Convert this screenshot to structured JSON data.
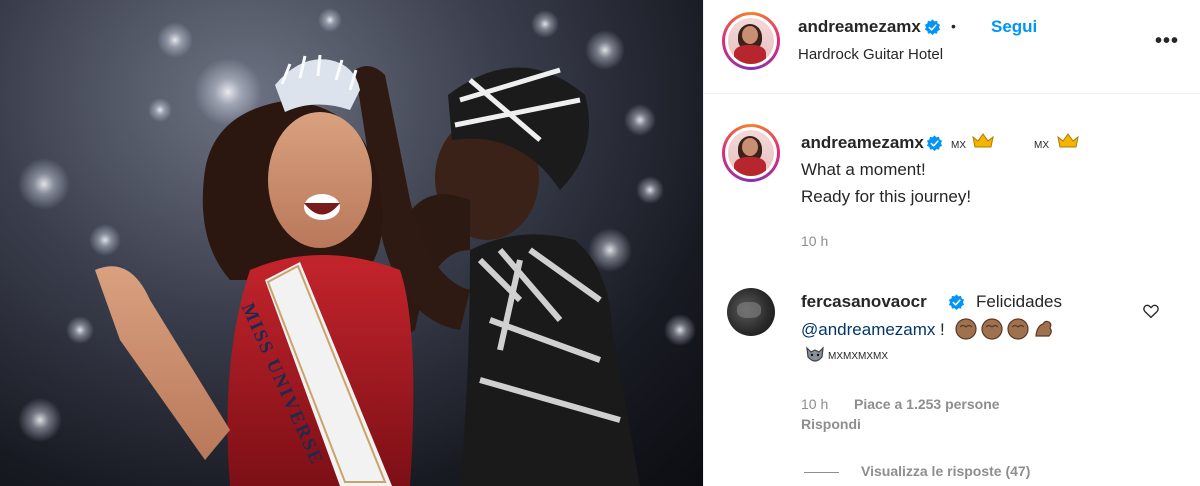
{
  "post": {
    "header": {
      "username": "andreamezamx",
      "follow_label": "Segui",
      "location": "Hardrock Guitar Hotel",
      "more_label": "•••"
    },
    "caption": {
      "username": "andreamezamx",
      "flag_1": "MX",
      "flag_2": "MX",
      "line_1": "What a moment!",
      "line_2": "Ready for this journey!",
      "time": "10 h"
    },
    "photo": {
      "sash_text": "MISS UNIVERSE"
    },
    "comment": {
      "username": "fercasanovaocr",
      "text": "Felicidades",
      "mention": "@andreamezamx",
      "after_mention": "!",
      "flags": "MXMXMXMX",
      "time": "10 h",
      "likes": "Piace a 1.253 persone",
      "reply_label": "Rispondi",
      "view_replies": "Visualizza le risposte (47)"
    },
    "colors": {
      "accent_blue": "#0095f6",
      "mention_blue": "#00376b",
      "muted": "#8e8e8e",
      "text": "#262626"
    }
  }
}
